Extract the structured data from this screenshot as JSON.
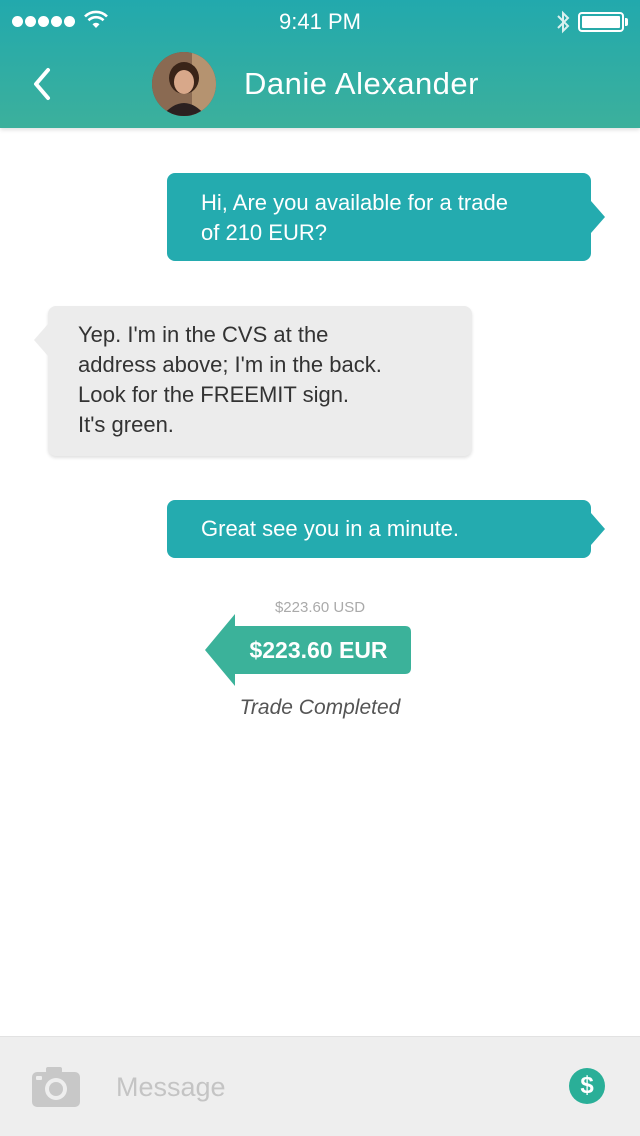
{
  "status_bar": {
    "time": "9:41 PM",
    "signal_icon": "signal-dots-icon",
    "wifi_icon": "wifi-icon",
    "bluetooth_icon": "bluetooth-icon",
    "battery_icon": "battery-icon",
    "battery_level": 1.0
  },
  "header": {
    "back_icon": "chevron-left-icon",
    "contact_name": "Danie Alexander",
    "avatar": "contact-avatar",
    "gradient_top": "#22a9ad",
    "gradient_bottom": "#3cb09c"
  },
  "messages": [
    {
      "direction": "outgoing",
      "text": "Hi, Are you available for a trade\nof 210 EUR?"
    },
    {
      "direction": "incoming",
      "text": "Yep. I'm in the CVS at the\naddress above; I'm in the back.\nLook for the FREEMIT sign.\nIt's green."
    },
    {
      "direction": "outgoing",
      "text": "Great see you in a minute."
    }
  ],
  "trade": {
    "usd_amount": "$223.60 USD",
    "eur_amount": "$223.60 EUR",
    "status": "Trade Completed",
    "arrow_color": "#3bb29a"
  },
  "composer": {
    "camera_icon": "camera-icon",
    "placeholder": "Message",
    "value": "",
    "send_money_icon": "dollar-icon",
    "send_money_symbol": "$"
  },
  "colors": {
    "outgoing_bubble": "#24abaf",
    "incoming_bubble": "#ececec",
    "accent": "#2aaf98"
  }
}
